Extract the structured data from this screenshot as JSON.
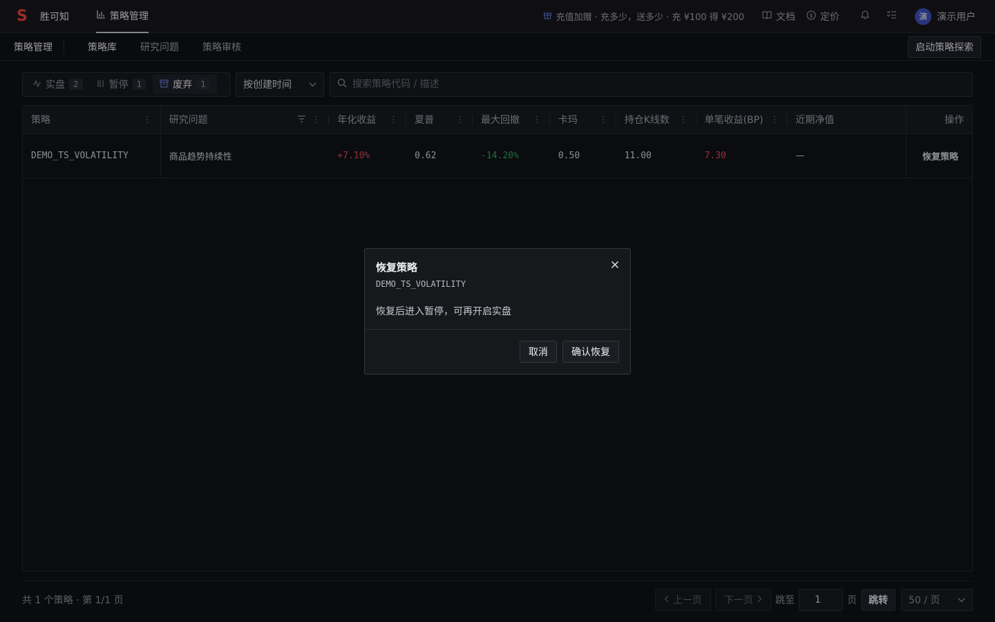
{
  "topbar": {
    "brand_logo": "S",
    "brand_name": "胜可知",
    "nav_active": "策略管理",
    "promo": "充值加赠 · 充多少，送多少 · 充 ¥100 得 ¥200",
    "docs": "文档",
    "pricing": "定价",
    "avatar_char": "演",
    "user_name": "演示用户"
  },
  "subbar": {
    "title": "策略管理",
    "tabs": [
      "策略库",
      "研究问题",
      "策略审核"
    ],
    "active_tab": "策略库",
    "launch_button": "启动策略探索"
  },
  "filters": {
    "status": [
      {
        "label": "实盘",
        "count": "2",
        "icon": "activity-icon"
      },
      {
        "label": "暂停",
        "count": "1",
        "icon": "pause-icon"
      },
      {
        "label": "废弃",
        "count": "1",
        "icon": "archive-icon"
      }
    ],
    "active_status": "废弃",
    "sort": "按创建时间",
    "search_placeholder": "搜索策略代码 / 描述"
  },
  "table": {
    "columns": [
      "策略",
      "研究问题",
      "年化收益",
      "夏普",
      "最大回撤",
      "卡玛",
      "持仓K线数",
      "单笔收益(BP)",
      "近期净值",
      "操作"
    ],
    "rows": [
      {
        "strategy": "DEMO_TS_VOLATILITY",
        "question": "商品趋势持续性",
        "annual": "+7.10%",
        "sharpe": "0.62",
        "max_dd": "-14.20%",
        "calmar": "0.50",
        "bars": "11.00",
        "bp": "7.30",
        "nav": "—",
        "action": "恢复策略"
      }
    ]
  },
  "footer": {
    "total": "共 1 个策略 · 第 1/1 页",
    "prev": "上一页",
    "next": "下一页",
    "jump_label": "跳至",
    "jump_value": "1",
    "page_unit": "页",
    "jump_button": "跳转",
    "page_size": "50 / 页"
  },
  "modal": {
    "title": "恢复策略",
    "code": "DEMO_TS_VOLATILITY",
    "description": "恢复后进入暂停，可再开启实盘",
    "cancel": "取消",
    "confirm": "确认恢复"
  }
}
